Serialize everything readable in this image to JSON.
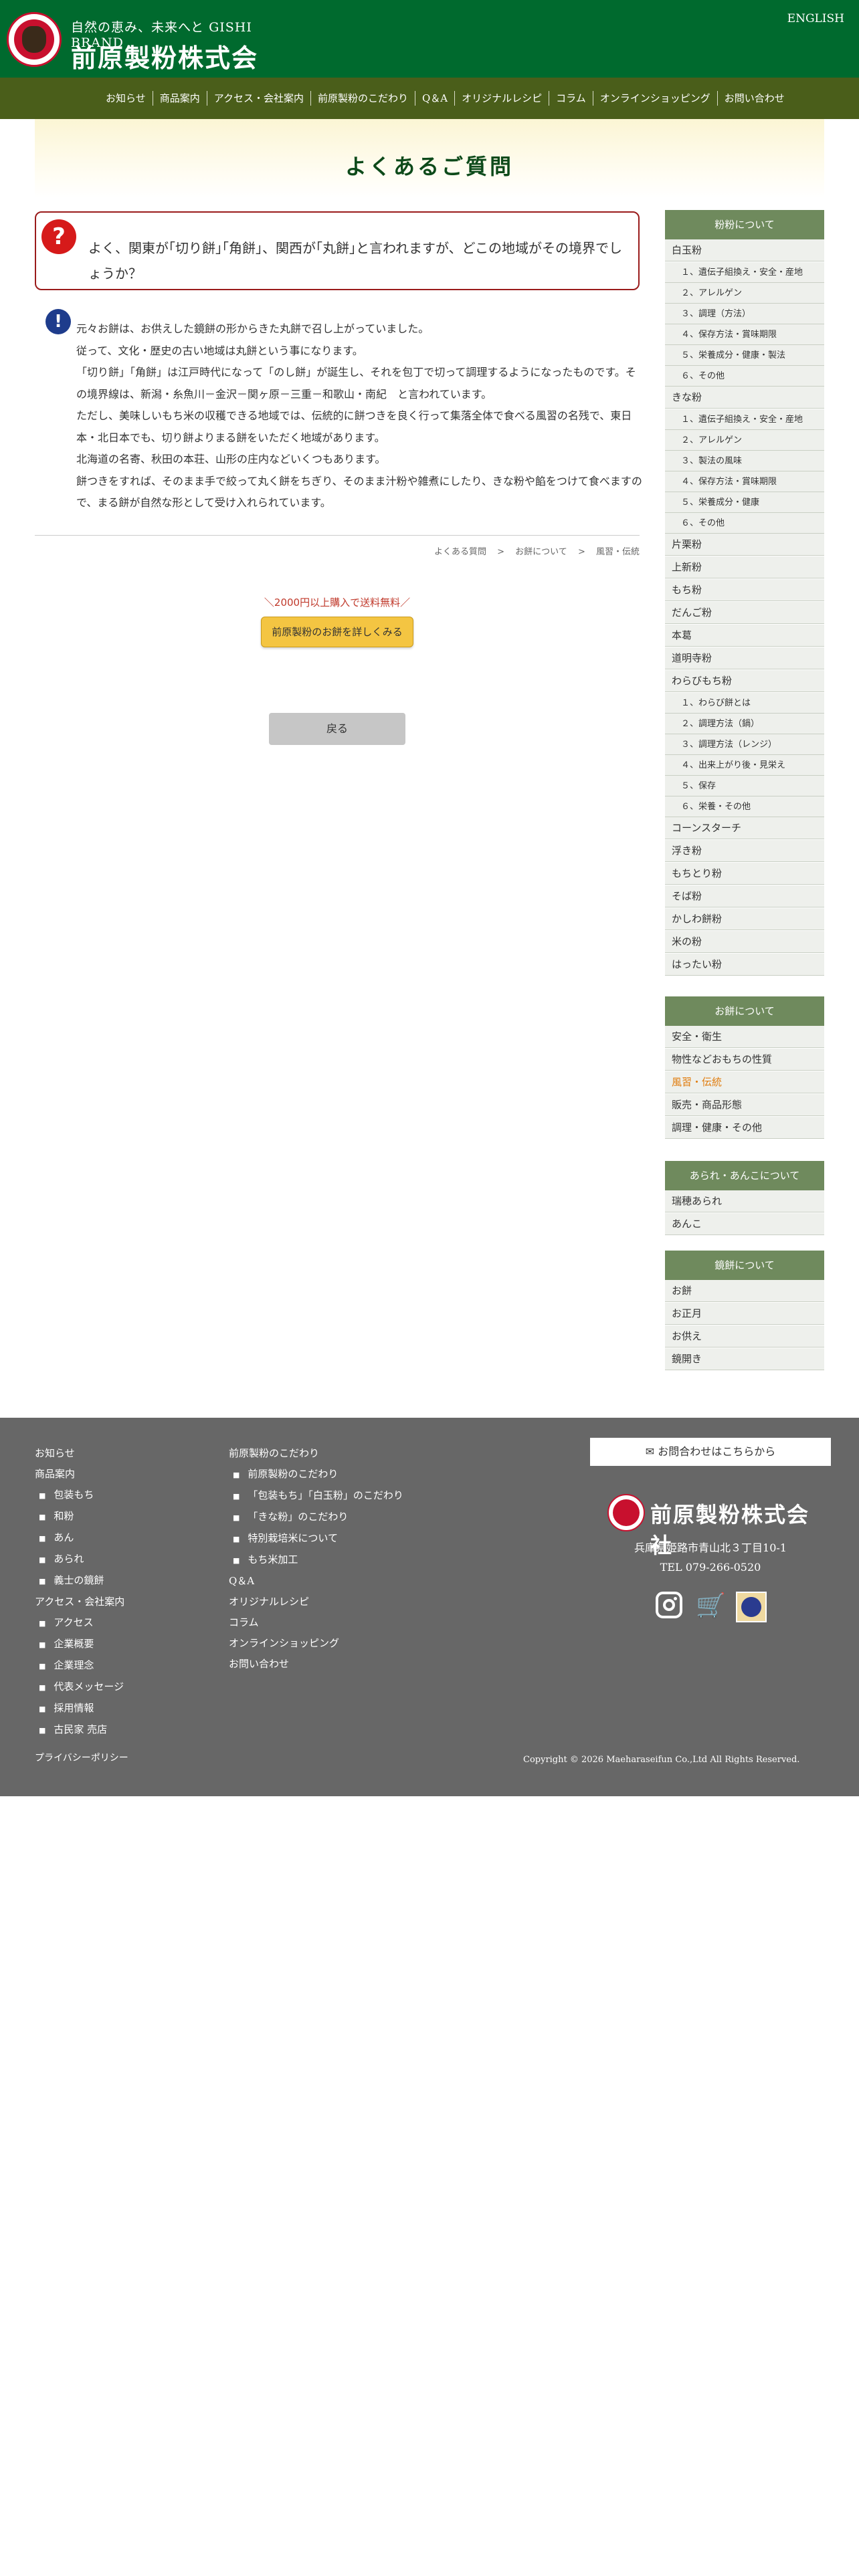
{
  "header": {
    "tagline": "自然の恵み、未来へと GISHI BRAND",
    "company_name": "前原製粉株式会社",
    "english_link": "ENGLISH"
  },
  "nav": {
    "items": [
      "お知らせ",
      "商品案内",
      "アクセス・会社案内",
      "前原製粉のこだわり",
      "Q＆A",
      "オリジナルレシピ",
      "コラム",
      "オンラインショッピング",
      "お問い合わせ"
    ]
  },
  "page": {
    "title": "よくあるご質問"
  },
  "question": {
    "icon": "?",
    "text": "よく、関東が｢切り餅｣｢角餅｣、関西が｢丸餅｣と言われますが、どこの地域がその境界でしょうか？"
  },
  "answer": {
    "icon": "!",
    "lines": [
      "元々お餅は、お供えした鏡餅の形からきた丸餅で召し上がっていました。",
      "従って、文化・歴史の古い地域は丸餅という事になります。",
      "「切り餅」「角餅」は江戸時代になって「のし餅」が誕生し、それを包丁で切って調理するようになったものです。その境界線は、新潟・糸魚川－金沢－関ヶ原－三重－和歌山・南紀　と言われています。",
      "ただし、美味しいもち米の収穫できる地域では、伝統的に餅つきを良く行って集落全体で食べる風習の名残で、東日本・北日本でも、切り餅よりまる餅をいただく地域があります。",
      "北海道の名寄、秋田の本荘、山形の庄内などいくつもあります。",
      "餅つきをすれば、そのまま手で絞って丸く餅をちぎり、そのまま汁粉や雑煮にしたり、きな粉や餡をつけて食べますので、まる餅が自然な形として受け入れられています。"
    ]
  },
  "breadcrumb": {
    "items": [
      "よくある質問",
      "お餅について",
      "風習・伝統"
    ],
    "separator": ">"
  },
  "promo": {
    "note": "＼2000円以上購入で送料無料／",
    "button": "前原製粉のお餅を詳しくみる"
  },
  "back_button": "戻る",
  "sidebar": {
    "sections": [
      {
        "title": "粉粉について",
        "items": [
          {
            "label": "白玉粉",
            "sub": false
          },
          {
            "label": "１、遺伝子組換え・安全・産地",
            "sub": true
          },
          {
            "label": "２、アレルゲン",
            "sub": true
          },
          {
            "label": "３、調理（方法）",
            "sub": true
          },
          {
            "label": "４、保存方法・賞味期限",
            "sub": true
          },
          {
            "label": "５、栄養成分・健康・製法",
            "sub": true
          },
          {
            "label": "６、その他",
            "sub": true
          },
          {
            "label": "きな粉",
            "sub": false
          },
          {
            "label": "１、遺伝子組換え・安全・産地",
            "sub": true
          },
          {
            "label": "２、アレルゲン",
            "sub": true
          },
          {
            "label": "３、製法の風味",
            "sub": true
          },
          {
            "label": "４、保存方法・賞味期限",
            "sub": true
          },
          {
            "label": "５、栄養成分・健康",
            "sub": true
          },
          {
            "label": "６、その他",
            "sub": true
          },
          {
            "label": "片栗粉",
            "sub": false
          },
          {
            "label": "上新粉",
            "sub": false
          },
          {
            "label": "もち粉",
            "sub": false
          },
          {
            "label": "だんご粉",
            "sub": false
          },
          {
            "label": "本葛",
            "sub": false
          },
          {
            "label": "道明寺粉",
            "sub": false
          },
          {
            "label": "わらびもち粉",
            "sub": false
          },
          {
            "label": "１、わらび餅とは",
            "sub": true
          },
          {
            "label": "２、調理方法（鍋）",
            "sub": true
          },
          {
            "label": "３、調理方法（レンジ）",
            "sub": true
          },
          {
            "label": "４、出来上がり後・見栄え",
            "sub": true
          },
          {
            "label": "５、保存",
            "sub": true
          },
          {
            "label": "６、栄養・その他",
            "sub": true
          },
          {
            "label": "コーンスターチ",
            "sub": false
          },
          {
            "label": "浮き粉",
            "sub": false
          },
          {
            "label": "もちとり粉",
            "sub": false
          },
          {
            "label": "そば粉",
            "sub": false
          },
          {
            "label": "かしわ餅粉",
            "sub": false
          },
          {
            "label": "米の粉",
            "sub": false
          },
          {
            "label": "はったい粉",
            "sub": false
          }
        ]
      },
      {
        "title": "お餅について",
        "items": [
          {
            "label": "安全・衛生",
            "sub": false
          },
          {
            "label": "物性などおもちの性質",
            "sub": false
          },
          {
            "label": "風習・伝統",
            "sub": false,
            "active": true
          },
          {
            "label": "販売・商品形態",
            "sub": false
          },
          {
            "label": "調理・健康・その他",
            "sub": false
          }
        ]
      },
      {
        "title": "あられ・あんこについて",
        "items": [
          {
            "label": "瑞穂あられ",
            "sub": false
          },
          {
            "label": "あんこ",
            "sub": false
          }
        ]
      },
      {
        "title": "鏡餅について",
        "items": [
          {
            "label": "お餅",
            "sub": false
          },
          {
            "label": "お正月",
            "sub": false
          },
          {
            "label": "お供え",
            "sub": false
          },
          {
            "label": "鏡開き",
            "sub": false
          }
        ]
      }
    ]
  },
  "footer": {
    "col1": [
      {
        "label": "お知らせ",
        "sub": false
      },
      {
        "label": "商品案内",
        "sub": false
      },
      {
        "label": "包装もち",
        "sub": true
      },
      {
        "label": "和粉",
        "sub": true
      },
      {
        "label": "あん",
        "sub": true
      },
      {
        "label": "あられ",
        "sub": true
      },
      {
        "label": "義士の鏡餅",
        "sub": true
      },
      {
        "label": "アクセス・会社案内",
        "sub": false
      },
      {
        "label": "アクセス",
        "sub": true
      },
      {
        "label": "企業概要",
        "sub": true
      },
      {
        "label": "企業理念",
        "sub": true
      },
      {
        "label": "代表メッセージ",
        "sub": true
      },
      {
        "label": "採用情報",
        "sub": true
      },
      {
        "label": "古民家 売店",
        "sub": true
      }
    ],
    "col2": [
      {
        "label": "前原製粉のこだわり",
        "sub": false
      },
      {
        "label": "前原製粉のこだわり",
        "sub": true
      },
      {
        "label": "「包装もち」「白玉粉」のこだわり",
        "sub": true
      },
      {
        "label": "「きな粉」のこだわり",
        "sub": true
      },
      {
        "label": "特別栽培米について",
        "sub": true
      },
      {
        "label": "もち米加工",
        "sub": true
      },
      {
        "label": "Q＆A",
        "sub": false
      },
      {
        "label": "オリジナルレシピ",
        "sub": false
      },
      {
        "label": "コラム",
        "sub": false
      },
      {
        "label": "オンラインショッピング",
        "sub": false
      },
      {
        "label": "お問い合わせ",
        "sub": false
      }
    ],
    "contact_button": "お問合わせはこちらから",
    "company_name": "前原製粉株式会社",
    "address": "兵庫県姫路市青山北３丁目10-1",
    "tel": "TEL 079-266-0520",
    "privacy": "プライバシーポリシー",
    "copyright": "Copyright © 2026 Maeharaseifun Co.,Ltd All Rights Reserved."
  }
}
